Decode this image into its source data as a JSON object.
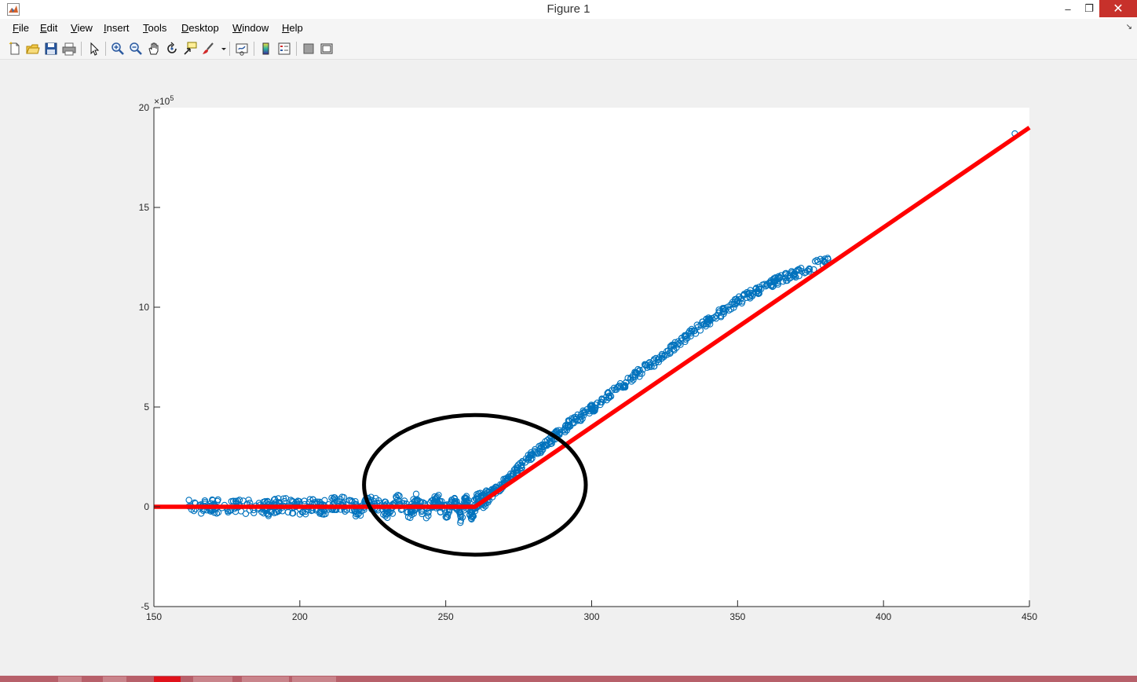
{
  "window": {
    "title": "Figure 1",
    "minimize_glyph": "–",
    "maximize_glyph": "❐",
    "close_glyph": "✕"
  },
  "menu": [
    {
      "label": "File"
    },
    {
      "label": "Edit"
    },
    {
      "label": "View"
    },
    {
      "label": "Insert"
    },
    {
      "label": "Tools"
    },
    {
      "label": "Desktop"
    },
    {
      "label": "Window"
    },
    {
      "label": "Help"
    }
  ],
  "toolbar": [
    "new-figure-icon",
    "open-file-icon",
    "save-icon",
    "print-icon",
    "edit-plot-arrow-icon",
    "zoom-in-icon",
    "zoom-out-icon",
    "pan-hand-icon",
    "rotate-3d-icon",
    "data-cursor-icon",
    "brush-icon",
    "brush-dropdown-icon",
    "link-plot-icon",
    "colorbar-icon",
    "legend-icon",
    "hide-plot-tools-icon",
    "show-plot-tools-icon"
  ],
  "colors": {
    "scatter": "#0072BD",
    "fit_line": "#FF0000",
    "annotation": "#000000",
    "axes_bg": "#FFFFFF",
    "figure_bg": "#F0F0F0",
    "close_button": "#C7312B"
  },
  "chart_data": {
    "type": "scatter",
    "title": "",
    "xlabel": "",
    "ylabel": "",
    "xlim": [
      150,
      450
    ],
    "ylim": [
      -5,
      20
    ],
    "y_exponent_label": "×10",
    "y_exponent_power": "5",
    "xticks": [
      150,
      200,
      250,
      300,
      350,
      400,
      450
    ],
    "xtick_labels": [
      "150",
      "200",
      "250",
      "300",
      "350",
      "400",
      "450"
    ],
    "yticks": [
      -5,
      0,
      5,
      10,
      15,
      20
    ],
    "ytick_labels": [
      "-5",
      "0",
      "5",
      "10",
      "15",
      "20"
    ],
    "grid": false,
    "legend": "none",
    "series": [
      {
        "kind": "scatter",
        "marker": "o",
        "points": [
          [
            162,
            0.02
          ],
          [
            168,
            0.0
          ],
          [
            171,
            0.05
          ],
          [
            178,
            -0.03
          ],
          [
            185,
            0.05
          ],
          [
            189,
            -0.1
          ],
          [
            192,
            0.1
          ],
          [
            196,
            0.05
          ],
          [
            200,
            -0.1
          ],
          [
            205,
            0.15
          ],
          [
            208,
            -0.05
          ],
          [
            212,
            0.2
          ],
          [
            216,
            0.1
          ],
          [
            220,
            -0.15
          ],
          [
            224,
            0.25
          ],
          [
            228,
            0.05
          ],
          [
            230,
            -0.2
          ],
          [
            234,
            0.3
          ],
          [
            238,
            -0.25
          ],
          [
            240,
            0.3
          ],
          [
            244,
            -0.3
          ],
          [
            247,
            0.35
          ],
          [
            250,
            -0.3
          ],
          [
            253,
            0.4
          ],
          [
            255,
            -0.45
          ],
          [
            257,
            0.3
          ],
          [
            259,
            -0.3
          ],
          [
            261,
            0.4
          ],
          [
            263,
            0.3
          ],
          [
            265,
            0.6
          ],
          [
            267,
            0.8
          ],
          [
            270,
            1.2
          ],
          [
            273,
            1.6
          ],
          [
            276,
            2.1
          ],
          [
            280,
            2.6
          ],
          [
            284,
            3.1
          ],
          [
            288,
            3.6
          ],
          [
            292,
            4.1
          ],
          [
            296,
            4.5
          ],
          [
            300,
            4.9
          ],
          [
            305,
            5.5
          ],
          [
            310,
            6.0
          ],
          [
            315,
            6.6
          ],
          [
            320,
            7.1
          ],
          [
            325,
            7.6
          ],
          [
            330,
            8.2
          ],
          [
            335,
            8.8
          ],
          [
            340,
            9.3
          ],
          [
            345,
            9.8
          ],
          [
            350,
            10.3
          ],
          [
            355,
            10.7
          ],
          [
            360,
            11.1
          ],
          [
            363,
            11.3
          ],
          [
            368,
            11.6
          ],
          [
            372,
            11.8
          ],
          [
            381,
            12.4
          ],
          [
            445,
            18.7
          ]
        ]
      },
      {
        "kind": "line",
        "points": [
          [
            150,
            0.0
          ],
          [
            260,
            0.0
          ],
          [
            450,
            19.0
          ]
        ]
      }
    ],
    "annotations": [
      {
        "kind": "ellipse",
        "center": [
          260,
          1.1
        ],
        "radius_x": 38,
        "radius_y": 3.5
      }
    ]
  }
}
